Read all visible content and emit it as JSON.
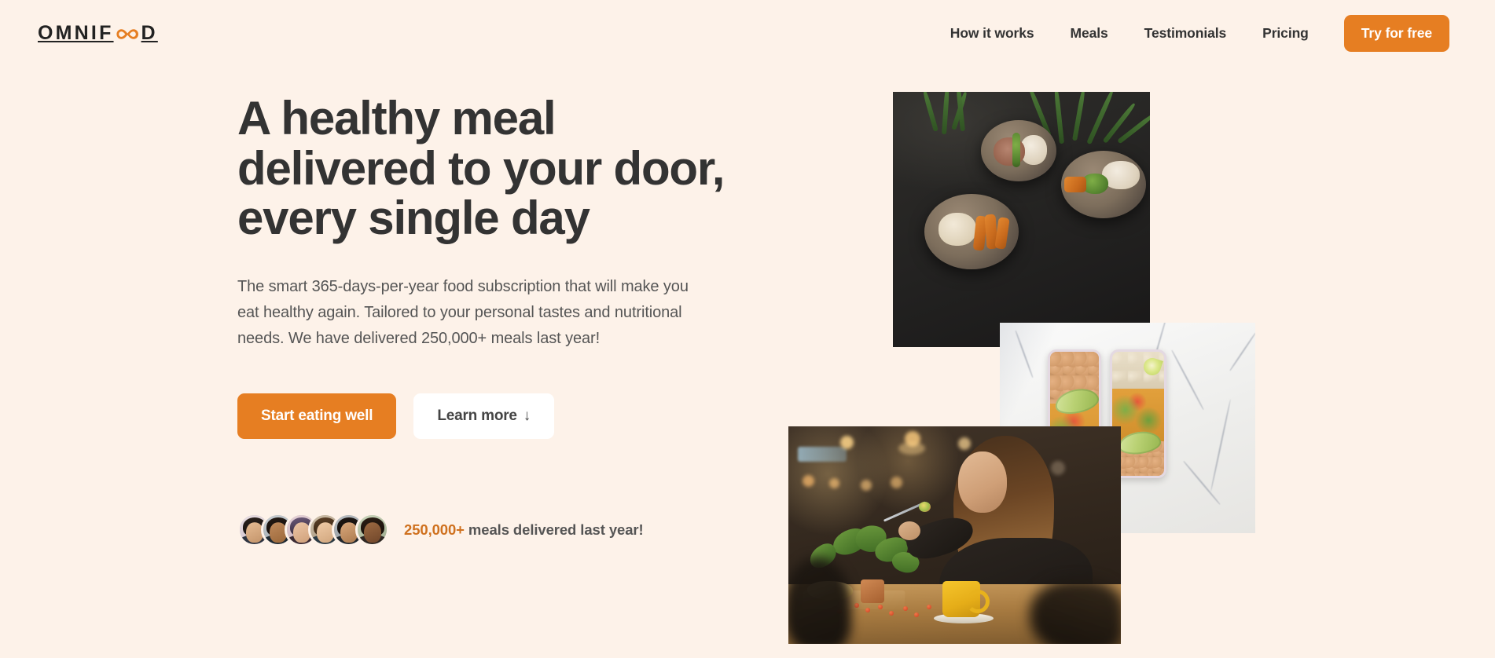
{
  "brand": {
    "name_start": "OMNIF",
    "infinity_icon": "infinity-icon",
    "name_end": "D",
    "accent_color": "#e67e22"
  },
  "header": {
    "nav": [
      {
        "label": "How it works"
      },
      {
        "label": "Meals"
      },
      {
        "label": "Testimonials"
      },
      {
        "label": "Pricing"
      }
    ],
    "cta_label": "Try for free"
  },
  "hero": {
    "heading": "A healthy meal delivered to your door, every single day",
    "description": "The smart 365-days-per-year food subscription that will make you eat healthy again. Tailored to your personal tastes and nutritional needs. We have delivered 250,000+ meals last year!",
    "primary_button": "Start eating well",
    "secondary_button": "Learn more",
    "secondary_button_arrow": "↓",
    "delivered": {
      "count": "250,000+",
      "text": " meals delivered last year!",
      "avatar_count": 6,
      "avatars": [
        {
          "name": "customer-avatar-1"
        },
        {
          "name": "customer-avatar-2"
        },
        {
          "name": "customer-avatar-3"
        },
        {
          "name": "customer-avatar-4"
        },
        {
          "name": "customer-avatar-5"
        },
        {
          "name": "customer-avatar-6"
        }
      ]
    },
    "images": [
      {
        "name": "hero-photo-bowls",
        "alt": "Bowls of healthy food on a dark table"
      },
      {
        "name": "hero-photo-mealprep",
        "alt": "Meal prep containers on marble surface"
      },
      {
        "name": "hero-photo-woman-eating",
        "alt": "Woman enjoying a meal in a cafe"
      }
    ]
  },
  "colors": {
    "background": "#fdf2e9",
    "accent": "#e67e22",
    "accent_dark": "#cf711f",
    "heading": "#333333",
    "body_text": "#555555"
  }
}
